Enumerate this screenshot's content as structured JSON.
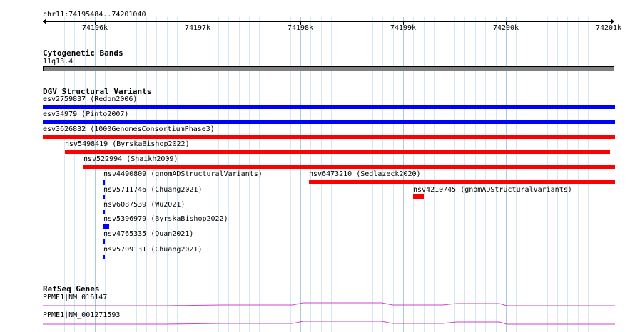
{
  "ruler": {
    "location": "chr11:74195484..74201040",
    "ticks": [
      "74196k",
      "74197k",
      "74198k",
      "74199k",
      "74200k",
      "74201k"
    ]
  },
  "tracks": {
    "cytogenetic": {
      "title": "Cytogenetic Bands",
      "band_label": "11q13.4",
      "band_color": "#808080"
    },
    "dgv": {
      "title": "DGV Structural Variants",
      "colors": {
        "blue": "#0000ff",
        "red": "#ff0000"
      },
      "features": [
        {
          "label": "esv2759837 (Redon2006)",
          "color": "blue"
        },
        {
          "label": "esv34979 (Pinto2007)",
          "color": "blue"
        },
        {
          "label": "esv3626832 (1000GenomesConsortiumPhase3)",
          "color": "red"
        },
        {
          "label": "nsv5498419 (ByrskaBishop2022)",
          "color": "red"
        },
        {
          "label": "nsv522994 (Shaikh2009)",
          "color": "red"
        },
        {
          "label": "nsv4490809 (gnomADStructuralVariants)",
          "color": "blue"
        },
        {
          "label": "nsv6473210 (Sedlazeck2020)",
          "color": "red"
        },
        {
          "label": "nsv5711746 (Chuang2021)",
          "color": "blue"
        },
        {
          "label": "nsv4210745 (gnomADStructuralVariants)",
          "color": "red"
        },
        {
          "label": "nsv6087539 (Wu2021)",
          "color": "blue"
        },
        {
          "label": "nsv5396979 (ByrskaBishop2022)",
          "color": "blue"
        },
        {
          "label": "nsv4765335 (Quan2021)",
          "color": "blue"
        },
        {
          "label": "nsv5709131 (Chuang2021)",
          "color": "blue"
        }
      ]
    },
    "refseq": {
      "title": "RefSeq Genes",
      "color": "#cc44cc",
      "transcripts": [
        {
          "label": "PPME1|NM_016147"
        },
        {
          "label": "PPME1|NM_001271593"
        }
      ]
    }
  }
}
